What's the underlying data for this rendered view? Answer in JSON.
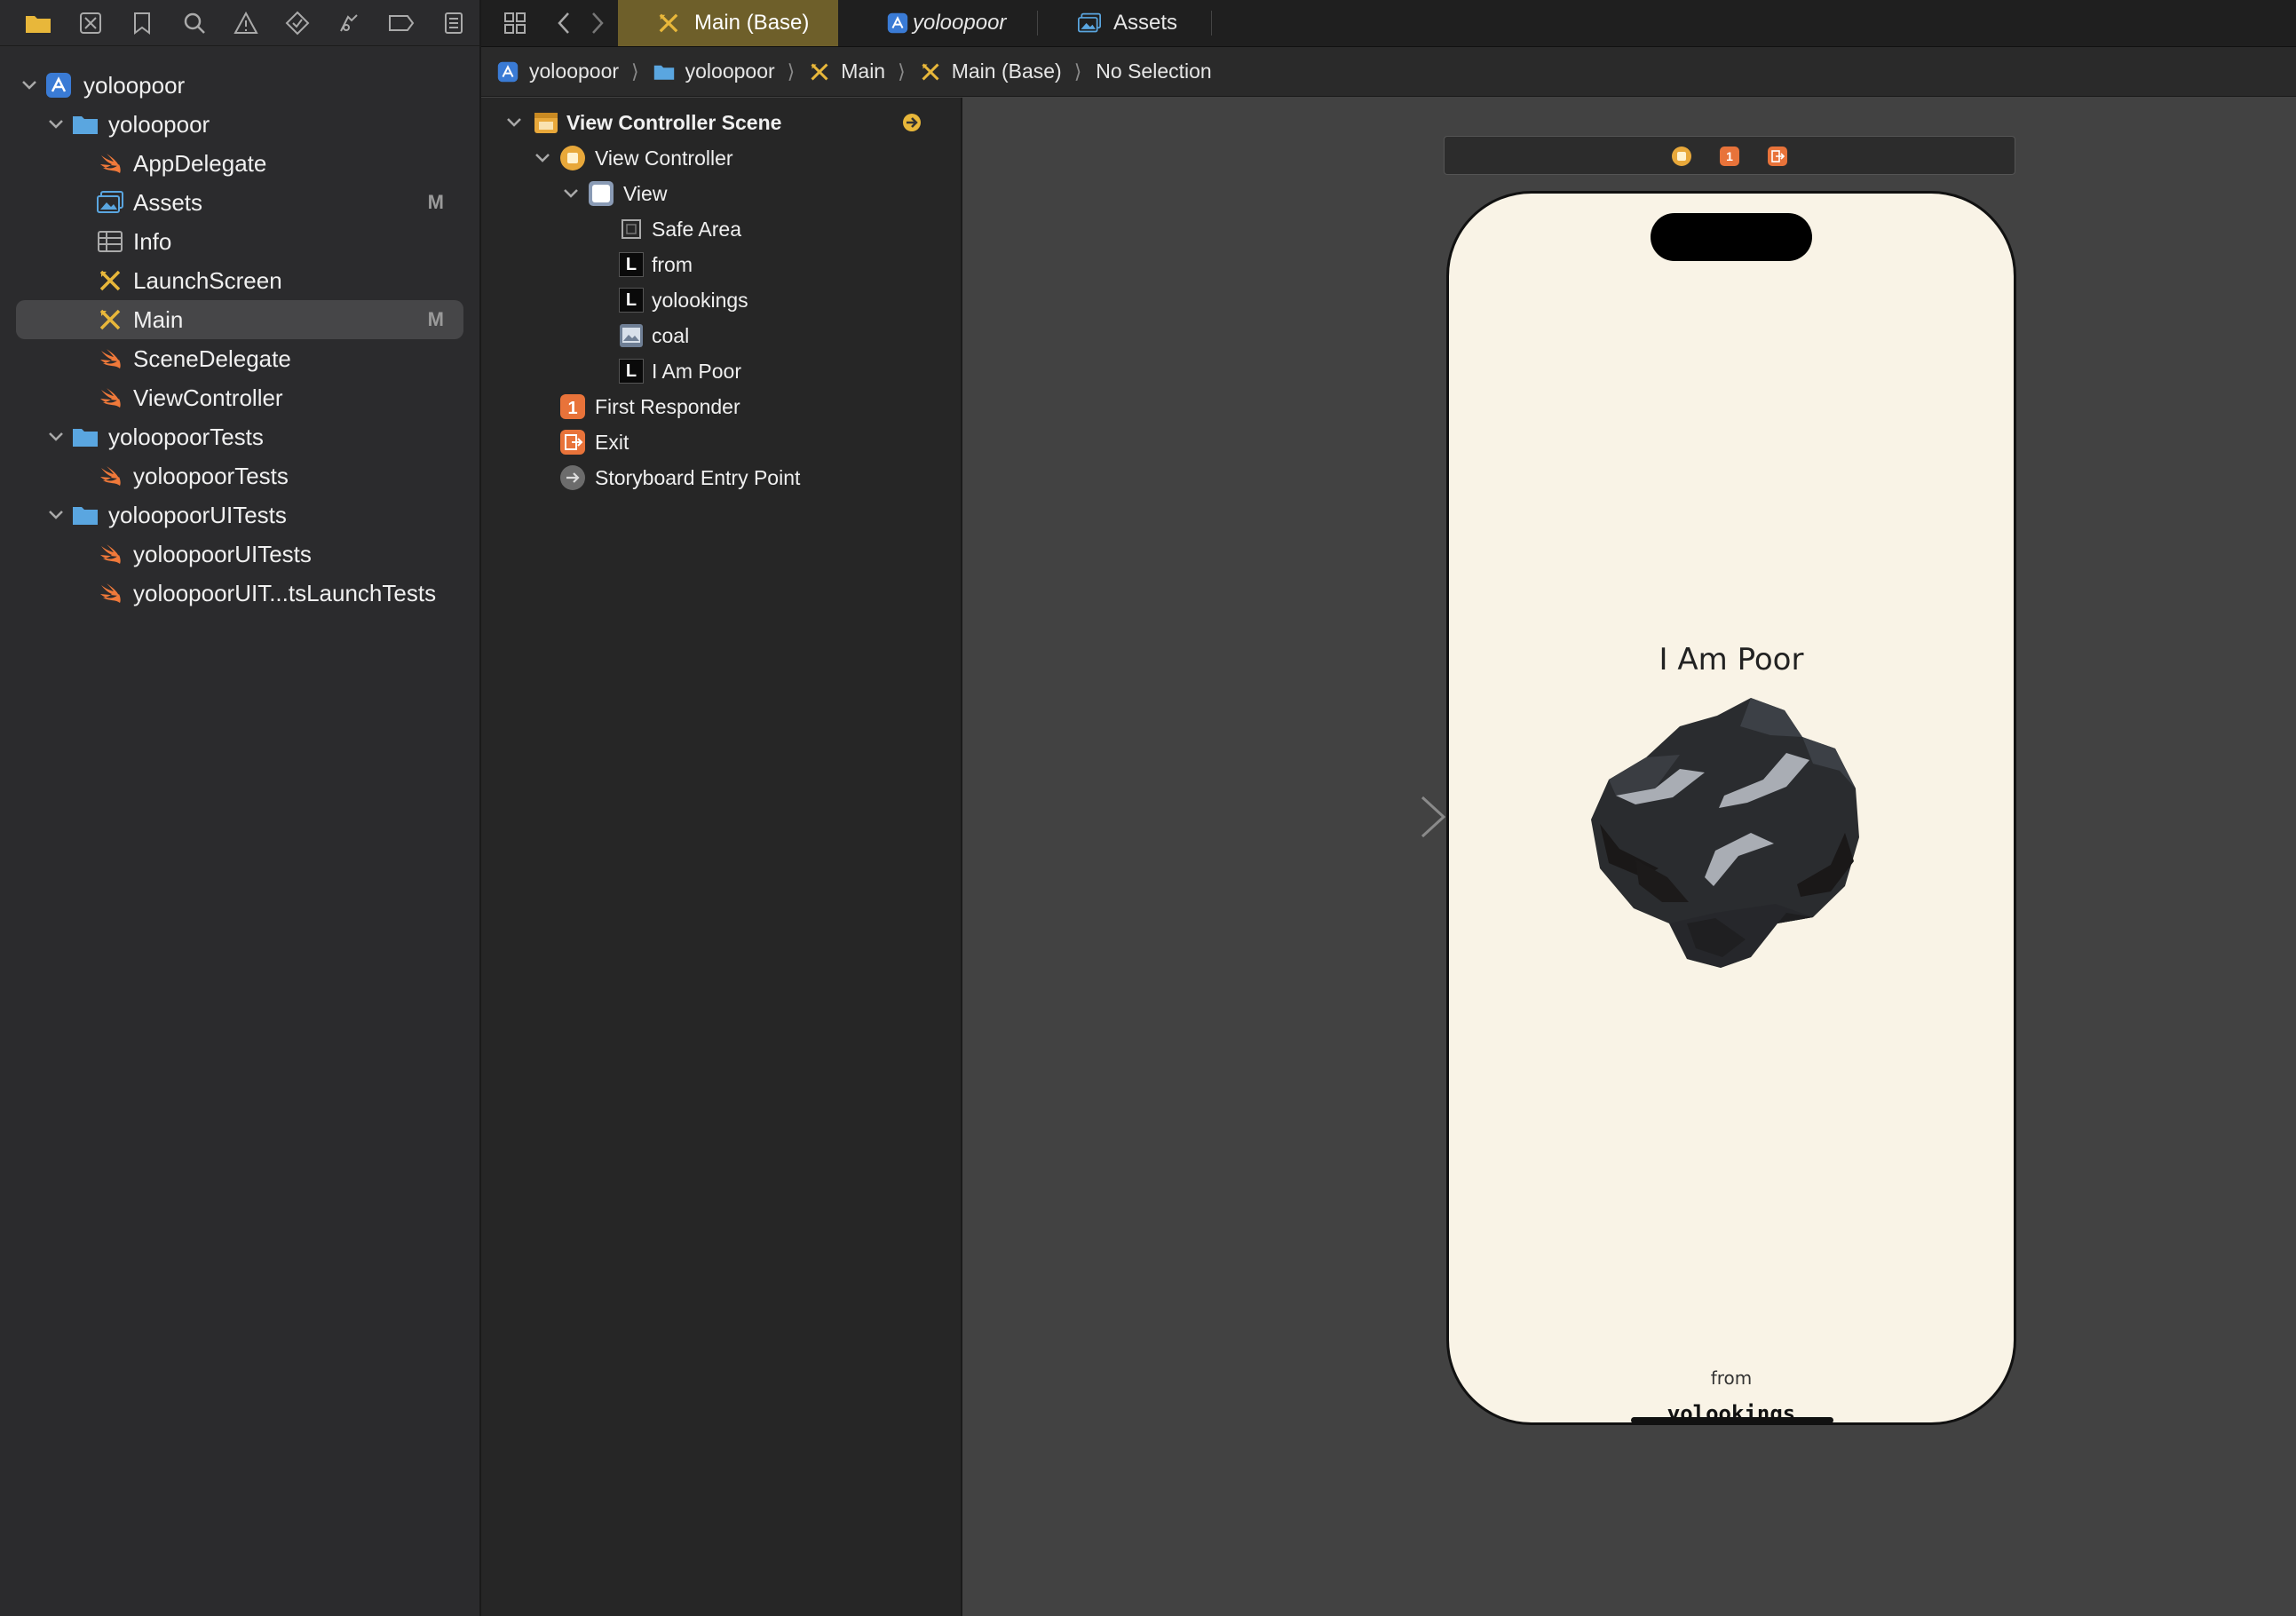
{
  "navigator": {
    "toolbar_icons": [
      "folder-icon",
      "source-control-icon",
      "bookmark-icon",
      "search-icon",
      "warning-icon",
      "test-icon",
      "debug-icon",
      "breakpoint-icon",
      "report-icon"
    ],
    "tree": [
      {
        "label": "yoloopoor",
        "icon": "project-icon",
        "level": 0,
        "expanded": true,
        "badge": ""
      },
      {
        "label": "yoloopoor",
        "icon": "folder-icon",
        "level": 1,
        "expanded": true,
        "badge": ""
      },
      {
        "label": "AppDelegate",
        "icon": "swift-icon",
        "level": 2,
        "badge": ""
      },
      {
        "label": "Assets",
        "icon": "assets-icon",
        "level": 2,
        "badge": "M"
      },
      {
        "label": "Info",
        "icon": "plist-icon",
        "level": 2,
        "badge": ""
      },
      {
        "label": "LaunchScreen",
        "icon": "storyboard-icon",
        "level": 2,
        "badge": ""
      },
      {
        "label": "Main",
        "icon": "storyboard-icon",
        "level": 2,
        "badge": "M",
        "selected": true
      },
      {
        "label": "SceneDelegate",
        "icon": "swift-icon",
        "level": 2,
        "badge": ""
      },
      {
        "label": "ViewController",
        "icon": "swift-icon",
        "level": 2,
        "badge": ""
      },
      {
        "label": "yoloopoorTests",
        "icon": "folder-icon",
        "level": 1,
        "expanded": true,
        "badge": ""
      },
      {
        "label": "yoloopoorTests",
        "icon": "swift-icon",
        "level": 2,
        "badge": ""
      },
      {
        "label": "yoloopoorUITests",
        "icon": "folder-icon",
        "level": 1,
        "expanded": true,
        "badge": ""
      },
      {
        "label": "yoloopoorUITests",
        "icon": "swift-icon",
        "level": 2,
        "badge": ""
      },
      {
        "label": "yoloopoorUIT...tsLaunchTests",
        "icon": "swift-icon",
        "level": 2,
        "badge": ""
      }
    ]
  },
  "tabs": [
    {
      "label": "Main (Base)",
      "icon": "storyboard-icon",
      "active": true
    },
    {
      "label": "yoloopoor",
      "icon": "project-icon",
      "italic": true
    },
    {
      "label": "Assets",
      "icon": "assets-icon"
    }
  ],
  "jumpbar": [
    {
      "label": "yoloopoor",
      "icon": "project-icon"
    },
    {
      "label": "yoloopoor",
      "icon": "folder-icon"
    },
    {
      "label": "Main",
      "icon": "storyboard-icon"
    },
    {
      "label": "Main (Base)",
      "icon": "storyboard-icon"
    },
    {
      "label": "No Selection",
      "icon": ""
    }
  ],
  "outline": {
    "scene": "View Controller Scene",
    "view_controller": "View Controller",
    "view": "View",
    "safe_area": "Safe Area",
    "label_from": "from",
    "label_yolookings": "yolookings",
    "image_coal": "coal",
    "label_iampoor": "I Am Poor",
    "first_responder": "First Responder",
    "exit": "Exit",
    "entry_point": "Storyboard Entry Point"
  },
  "canvas": {
    "title": "I Am Poor",
    "from_text": "from",
    "maker_text": "yolookings",
    "screen_bg": "#f9f3e6"
  },
  "colors": {
    "accent_tab": "#6e5f2a",
    "swift": "#f0793a",
    "folder": "#5aa6e0",
    "storyboard": "#e8b73a",
    "first_responder": "#e8733a"
  }
}
